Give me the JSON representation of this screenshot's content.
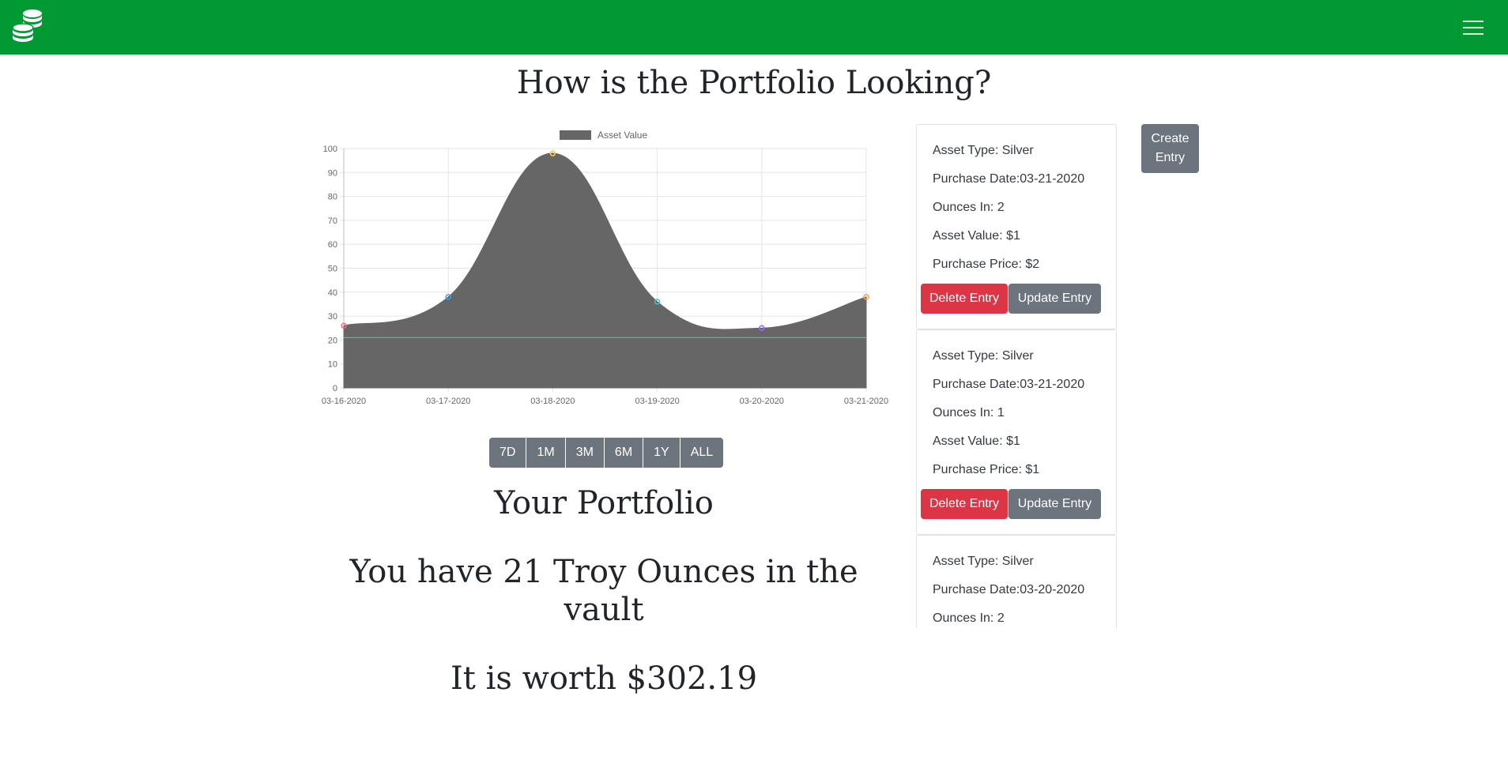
{
  "navbar": {
    "logo_icon": "coins-stack-icon",
    "menu_icon": "hamburger-menu-icon",
    "bg_color": "#009933"
  },
  "page": {
    "title": "How is the Portfolio Looking?"
  },
  "chart_data": {
    "type": "area",
    "title": "",
    "legend": [
      "Asset Value"
    ],
    "legend_placement": "top",
    "categories": [
      "03-16-2020",
      "03-17-2020",
      "03-18-2020",
      "03-19-2020",
      "03-20-2020",
      "03-21-2020"
    ],
    "series": [
      {
        "name": "Asset Value",
        "values": [
          26,
          38,
          98,
          36,
          25,
          38
        ],
        "fill_color": "#666666"
      },
      {
        "name": "",
        "values": [
          21,
          21,
          21,
          21,
          21,
          21
        ],
        "line_color": "#4bc0a0"
      }
    ],
    "point_colors": [
      "#ff6384",
      "#36a2eb",
      "#ffcd56",
      "#4bc0c0",
      "#9966ff",
      "#ff9f40"
    ],
    "y_ticks": [
      "0",
      "10",
      "20",
      "30",
      "40",
      "50",
      "60",
      "70",
      "80",
      "90",
      "100"
    ],
    "ylim": [
      0,
      100
    ],
    "grid": true
  },
  "range_buttons": [
    "7D",
    "1M",
    "3M",
    "6M",
    "1Y",
    "ALL"
  ],
  "summary": {
    "portfolio_heading": "Your Portfolio",
    "ounces_line1": "You have 21 Troy Ounces in the",
    "ounces_line2": "vault",
    "worth": "It is worth $302.19"
  },
  "entries": [
    {
      "asset_type": "Asset Type: Silver",
      "purchase_date": "Purchase Date:03-21-2020",
      "ounces": "Ounces In: 2",
      "asset_value": "Asset Value: $1",
      "purchase_price": "Purchase Price: $2",
      "delete_label": "Delete Entry",
      "update_label": "Update Entry"
    },
    {
      "asset_type": "Asset Type: Silver",
      "purchase_date": "Purchase Date:03-21-2020",
      "ounces": "Ounces In: 1",
      "asset_value": "Asset Value: $1",
      "purchase_price": "Purchase Price: $1",
      "delete_label": "Delete Entry",
      "update_label": "Update Entry"
    },
    {
      "asset_type": "Asset Type: Silver",
      "purchase_date": "Purchase Date:03-20-2020",
      "ounces": "Ounces In: 2"
    }
  ],
  "create_button": {
    "line1": "Create",
    "line2": "Entry"
  }
}
